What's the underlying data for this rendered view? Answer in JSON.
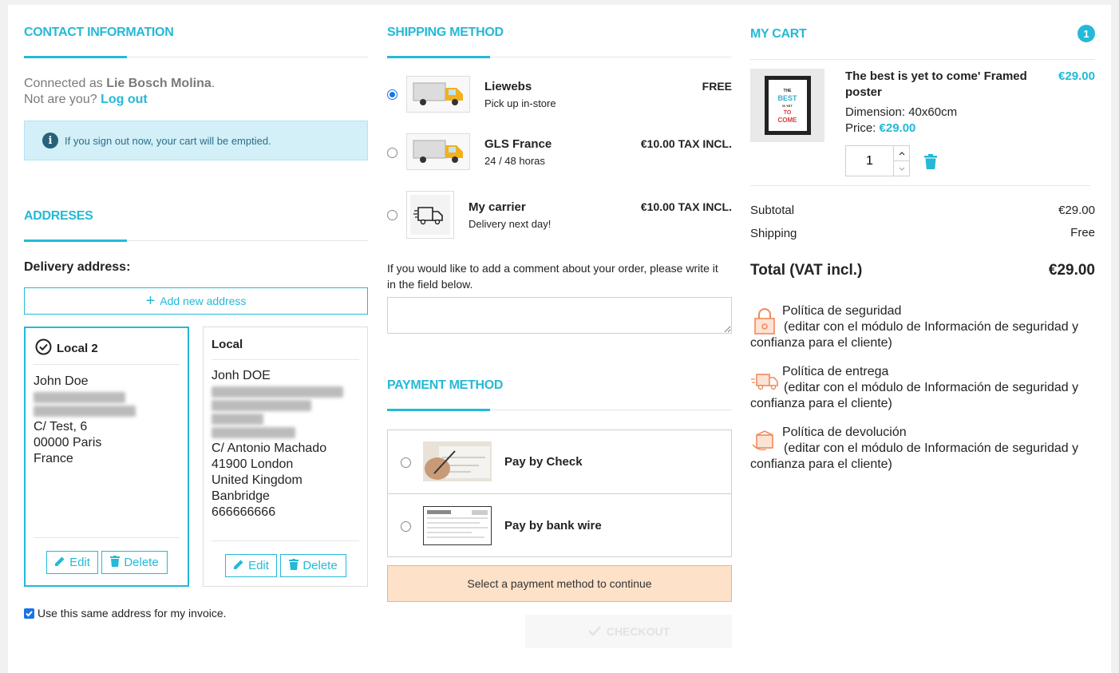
{
  "contact": {
    "title": "CONTACT INFORMATION",
    "connected_prefix": "Connected as ",
    "user_name": "Lie Bosch Molina",
    "connected_suffix": ".",
    "not_you": "Not are you?",
    "logout": "Log out",
    "signout_notice": "If you sign out now, your cart will be emptied."
  },
  "addresses": {
    "title": "ADDRESES",
    "delivery_label": "Delivery address:",
    "add_new": "Add new address",
    "cards": [
      {
        "alias": "Local 2",
        "selected": true,
        "name": "John Doe",
        "lines": [
          "C/ Test, 6",
          "00000 Paris",
          "France"
        ],
        "edit": "Edit",
        "delete": "Delete"
      },
      {
        "alias": "Local",
        "selected": false,
        "name": "Jonh DOE",
        "lines": [
          "C/ Antonio Machado",
          "41900 London",
          "United Kingdom",
          "Banbridge",
          "666666666"
        ],
        "edit": "Edit",
        "delete": "Delete"
      }
    ],
    "same_invoice": "Use this same address for my invoice.",
    "same_invoice_checked": true
  },
  "shipping": {
    "title": "SHIPPING METHOD",
    "carriers": [
      {
        "name": "Liewebs",
        "delay": "Pick up in-store",
        "price": "FREE",
        "selected": true,
        "icon": "truck-icon"
      },
      {
        "name": "GLS France",
        "delay": "24 / 48 horas",
        "price": "€10.00 TAX INCL.",
        "selected": false,
        "icon": "truck-icon"
      },
      {
        "name": "My carrier",
        "delay": "Delivery next day!",
        "price": "€10.00 TAX INCL.",
        "selected": false,
        "icon": "delivery-van-icon"
      }
    ],
    "comment_label": "If you would like to add a comment about your order, please write it in the field below."
  },
  "payment": {
    "title": "PAYMENT METHOD",
    "options": [
      {
        "label": "Pay by Check",
        "icon": "check-payment-icon"
      },
      {
        "label": "Pay by bank wire",
        "icon": "bank-wire-icon"
      }
    ],
    "warning": "Select a payment method to continue",
    "checkout": "CHECKOUT"
  },
  "cart": {
    "title": "MY CART",
    "count": "1",
    "product": {
      "name": "The best is yet to come' Framed poster",
      "price": "€29.00",
      "dimension_label": "Dimension:",
      "dimension_value": "40x60cm",
      "unit_price_label": "Price:",
      "unit_price": "€29.00",
      "quantity": "1",
      "poster_lines": [
        "THE",
        "BEST",
        "IS YET",
        "TO",
        "COME"
      ]
    },
    "subtotal_label": "Subtotal",
    "subtotal_value": "€29.00",
    "shipping_label": "Shipping",
    "shipping_value": "Free",
    "total_label": "Total (VAT incl.)",
    "total_value": "€29.00",
    "policies": [
      {
        "title": "Política de seguridad",
        "text": "(editar con el módulo de Información de seguridad y confianza para el cliente)",
        "icon": "lock-icon"
      },
      {
        "title": "Política de entrega",
        "text": "(editar con el módulo de Información de seguridad y confianza para el cliente)",
        "icon": "delivery-truck-icon"
      },
      {
        "title": "Política de devolución",
        "text": "(editar con el módulo de Información de seguridad y confianza para el cliente)",
        "icon": "return-box-icon"
      }
    ]
  },
  "colors": {
    "accent": "#24b9d7",
    "info_bg": "#d3eff8",
    "warning_bg": "#fde1c8",
    "policy_icon": "#f08a5d"
  }
}
